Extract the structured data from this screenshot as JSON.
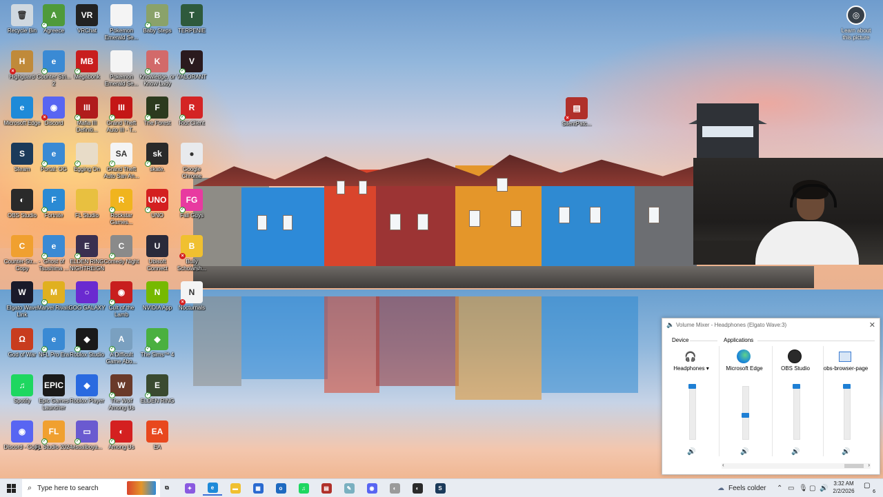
{
  "desktop": {
    "icons": [
      {
        "label": "Recycle Bin",
        "glyph": "🗑",
        "color": "#cfd8e0",
        "badge": ""
      },
      {
        "label": "Agreece",
        "glyph": "A",
        "color": "#4f9a3a",
        "badge": "ok"
      },
      {
        "label": "VRChat",
        "glyph": "VR",
        "color": "#222222",
        "badge": ""
      },
      {
        "label": "Pokemon Emerald Se...",
        "glyph": "",
        "color": "#f4f4f4",
        "badge": ""
      },
      {
        "label": "Baby Steps",
        "glyph": "B",
        "color": "#8aa26a",
        "badge": "ok"
      },
      {
        "label": "TERPENIE",
        "glyph": "T",
        "color": "#2e5a3c",
        "badge": ""
      },
      {
        "label": "Highguard",
        "glyph": "H",
        "color": "#c08a3a",
        "badge": "err"
      },
      {
        "label": "Counter Stri... 2",
        "glyph": "e",
        "color": "#3a8ad4",
        "badge": "ok"
      },
      {
        "label": "Megabonk",
        "glyph": "MB",
        "color": "#c81e1e",
        "badge": "ok"
      },
      {
        "label": "Pokemon Emerald Se...",
        "glyph": "",
        "color": "#f4f4f4",
        "badge": ""
      },
      {
        "label": "Knowledge, or Know Lady",
        "glyph": "K",
        "color": "#d26a6a",
        "badge": "ok"
      },
      {
        "label": "VALORANT",
        "glyph": "V",
        "color": "#2a1a1e",
        "badge": "ok"
      },
      {
        "label": "Microsoft Edge",
        "glyph": "e",
        "color": "#1e8ad8",
        "badge": ""
      },
      {
        "label": "Discord",
        "glyph": "◉",
        "color": "#5865f2",
        "badge": "err"
      },
      {
        "label": "Mafia III Definiti...",
        "glyph": "III",
        "color": "#b01c1c",
        "badge": "ok"
      },
      {
        "label": "Grand Theft Auto III - T...",
        "glyph": "III",
        "color": "#c41616",
        "badge": "ok"
      },
      {
        "label": "The Forest",
        "glyph": "F",
        "color": "#2c3a1e",
        "badge": "ok"
      },
      {
        "label": "Riot Client",
        "glyph": "R",
        "color": "#d42424",
        "badge": "ok"
      },
      {
        "label": "Steam",
        "glyph": "S",
        "color": "#1b3a5a",
        "badge": ""
      },
      {
        "label": "Portal: OG",
        "glyph": "e",
        "color": "#3a8ad4",
        "badge": "ok"
      },
      {
        "label": "Egging On",
        "glyph": "",
        "color": "#e8dcc8",
        "badge": "ok"
      },
      {
        "label": "Grand Theft Auto San An...",
        "glyph": "SA",
        "color": "#f4f4f4",
        "badge": "ok"
      },
      {
        "label": "skate.",
        "glyph": "sk",
        "color": "#2a2a2a",
        "badge": "ok"
      },
      {
        "label": "Google Chrome",
        "glyph": "●",
        "color": "#e8eaed",
        "badge": ""
      },
      {
        "label": "OBS Studio",
        "glyph": "◐",
        "color": "#2a2a2a",
        "badge": ""
      },
      {
        "label": "Fortnite",
        "glyph": "F",
        "color": "#2a8ad4",
        "badge": "ok"
      },
      {
        "label": "FL Studio",
        "glyph": "",
        "color": "#e8c040",
        "badge": ""
      },
      {
        "label": "Rockstar Games...",
        "glyph": "R",
        "color": "#f0b41e",
        "badge": "ok"
      },
      {
        "label": "UNO",
        "glyph": "UNO",
        "color": "#d42020",
        "badge": "ok"
      },
      {
        "label": "Fall Guys",
        "glyph": "FG",
        "color": "#e83aa0",
        "badge": "ok"
      },
      {
        "label": "Counter-Str... - Copy",
        "glyph": "C",
        "color": "#f0a030",
        "badge": ""
      },
      {
        "label": "Ghost of Tsushima ...",
        "glyph": "e",
        "color": "#3a8ad4",
        "badge": "ok"
      },
      {
        "label": "ELDEN RING NIGHTREIGN",
        "glyph": "E",
        "color": "#3a3050",
        "badge": "ok"
      },
      {
        "label": "Comedy Night",
        "glyph": "C",
        "color": "#8a8a8a",
        "badge": "ok"
      },
      {
        "label": "Ubisoft Connect",
        "glyph": "U",
        "color": "#2a2a3a",
        "badge": ""
      },
      {
        "label": "Bully Scholarsh...",
        "glyph": "B",
        "color": "#f0c030",
        "badge": "err"
      },
      {
        "label": "Elgato Wave Link",
        "glyph": "W",
        "color": "#1a1a2a",
        "badge": ""
      },
      {
        "label": "Marvel Rivals",
        "glyph": "M",
        "color": "#e0b020",
        "badge": "ok"
      },
      {
        "label": "GOG GALAXY",
        "glyph": "○",
        "color": "#6a2ad0",
        "badge": ""
      },
      {
        "label": "Cult of the Lamb",
        "glyph": "◉",
        "color": "#c81e1e",
        "badge": "ok"
      },
      {
        "label": "NVIDIA App",
        "glyph": "N",
        "color": "#76b900",
        "badge": ""
      },
      {
        "label": "Nocturnals",
        "glyph": "N",
        "color": "#f4f4f4",
        "badge": "err"
      },
      {
        "label": "God of War",
        "glyph": "Ω",
        "color": "#c83c1e",
        "badge": ""
      },
      {
        "label": "NFL Pro Era",
        "glyph": "e",
        "color": "#3a8ad4",
        "badge": "ok"
      },
      {
        "label": "Roblox Studio",
        "glyph": "◆",
        "color": "#1a1a1a",
        "badge": "ok"
      },
      {
        "label": "A Difficult Game Abo...",
        "glyph": "A",
        "color": "#7aa0c0",
        "badge": "ok"
      },
      {
        "label": "The Sims™ 4",
        "glyph": "◆",
        "color": "#4ab040",
        "badge": "ok"
      },
      {
        "label": "",
        "glyph": "",
        "color": "transparent",
        "badge": ""
      },
      {
        "label": "Spotify",
        "glyph": "♫",
        "color": "#1ed760",
        "badge": ""
      },
      {
        "label": "Epic Games Launcher",
        "glyph": "EPIC",
        "color": "#1a1a1a",
        "badge": ""
      },
      {
        "label": "Roblox Player",
        "glyph": "◆",
        "color": "#2a6ae0",
        "badge": ""
      },
      {
        "label": "The Wolf Among Us",
        "glyph": "W",
        "color": "#6a3a2a",
        "badge": "ok"
      },
      {
        "label": "ELDEN RING",
        "glyph": "E",
        "color": "#3a4a30",
        "badge": "ok"
      },
      {
        "label": "",
        "glyph": "",
        "color": "transparent",
        "badge": ""
      },
      {
        "label": "Discord - Copy",
        "glyph": "◉",
        "color": "#5865f2",
        "badge": ""
      },
      {
        "label": "FL Studio 2024",
        "glyph": "FL",
        "color": "#f0a030",
        "badge": "ok"
      },
      {
        "label": "visualboya...",
        "glyph": "▭",
        "color": "#6a5ad0",
        "badge": "ok"
      },
      {
        "label": "Among Us",
        "glyph": "◐",
        "color": "#d42020",
        "badge": "ok"
      },
      {
        "label": "EA",
        "glyph": "EA",
        "color": "#e8481e",
        "badge": ""
      },
      {
        "label": "",
        "glyph": "",
        "color": "transparent",
        "badge": ""
      }
    ],
    "stray_icon": {
      "label": "SilentPatc...",
      "glyph": "▤",
      "color": "#b0302a",
      "badge": "err"
    },
    "learn_label": "Learn about this picture"
  },
  "mixer": {
    "title": "Volume Mixer - Headphones (Elgato Wave:3)",
    "device_label": "Device",
    "applications_label": "Applications",
    "channels": [
      {
        "name": "Headphones ▾",
        "icon": "headphones-icon",
        "level": 1.0
      },
      {
        "name": "Microsoft Edge",
        "icon": "edge-icon",
        "level": 0.45
      },
      {
        "name": "OBS Studio",
        "icon": "obs-icon",
        "level": 1.0
      },
      {
        "name": "obs-browser-page",
        "icon": "browser-page-icon",
        "level": 1.0
      }
    ]
  },
  "taskbar": {
    "search_placeholder": "Type here to search",
    "weather": "Feels colder",
    "time": "3:32 AM",
    "date": "2/2/2026",
    "notifications": "6",
    "apps": [
      {
        "name": "task-view",
        "glyph": "⧉",
        "color": "transparent",
        "active": false
      },
      {
        "name": "copilot",
        "glyph": "✦",
        "color": "#8a5ae0",
        "active": false
      },
      {
        "name": "edge",
        "glyph": "e",
        "color": "#1e8ad8",
        "active": true
      },
      {
        "name": "file-explorer",
        "glyph": "▬",
        "color": "#f0c030",
        "active": false
      },
      {
        "name": "store",
        "glyph": "▦",
        "color": "#2a6ad0",
        "active": false
      },
      {
        "name": "outlook",
        "glyph": "o",
        "color": "#1e6ac0",
        "active": false
      },
      {
        "name": "spotify",
        "glyph": "♫",
        "color": "#1ed760",
        "active": false
      },
      {
        "name": "winrar",
        "glyph": "▤",
        "color": "#b0302a",
        "active": false
      },
      {
        "name": "notepad",
        "glyph": "✎",
        "color": "#7ab0c0",
        "active": false
      },
      {
        "name": "discord",
        "glyph": "◉",
        "color": "#5865f2",
        "active": false
      },
      {
        "name": "elgato",
        "glyph": "◐",
        "color": "#9a9a9a",
        "active": false
      },
      {
        "name": "obs",
        "glyph": "◐",
        "color": "#2a2a2a",
        "active": false
      },
      {
        "name": "steam",
        "glyph": "S",
        "color": "#1b3a5a",
        "active": false
      }
    ]
  }
}
